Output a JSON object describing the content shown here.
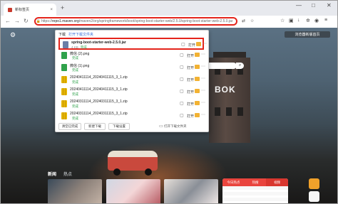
{
  "tab": {
    "title": "新标签页",
    "close_glyph": "×",
    "new_tab_glyph": "+"
  },
  "window": {
    "minimize": "—",
    "maximize": "□",
    "close": "✕"
  },
  "nav": {
    "back": "←",
    "forward": "→",
    "reload": "↻"
  },
  "address": {
    "scheme": "https://",
    "host": "repo1.maven.org",
    "path": "/maven2/org/springframework/boot/spring-boot-starter-web/2.5.0/spring-boot-starter-web-2.5.0.jar"
  },
  "page": {
    "weather": {
      "temp": "",
      "text_line1": "",
      "text_line2": ""
    },
    "browse_button": "浏览器新版首页",
    "news_tabs": [
      "新闻",
      "热点"
    ],
    "hot_tabs": [
      "今日热点",
      "热搜",
      "视频"
    ],
    "tower_logo": "BOK"
  },
  "downloads": {
    "title": "下载",
    "link": "打开下载文件夹",
    "items": [
      {
        "name": "spring-boot-starter-web-2.5.0.jar",
        "meta": "4 KB",
        "status": "完成",
        "icon": "jar-file-icon",
        "highlighted": true
      },
      {
        "name": "微信 (2).png",
        "meta": "",
        "status": "完成",
        "icon": "png-file-icon",
        "highlighted": false
      },
      {
        "name": "微信 (1).png",
        "meta": "",
        "status": "完成",
        "icon": "png-file-icon",
        "highlighted": false
      },
      {
        "name": "20240411114_20240411115_3_1.zip",
        "meta": "",
        "status": "完成",
        "icon": "zip-file-icon",
        "highlighted": false
      },
      {
        "name": "20240411114_20240411115_3_1.zip",
        "meta": "",
        "status": "完成",
        "icon": "zip-file-icon",
        "highlighted": false
      },
      {
        "name": "20240311114_20240311115_3_1.zip",
        "meta": "",
        "status": "完成",
        "icon": "zip-file-icon",
        "highlighted": false
      },
      {
        "name": "20240311114_20240311115_3_1.zip",
        "meta": "",
        "status": "完成",
        "icon": "zip-file-icon",
        "highlighted": false
      }
    ],
    "open_label": "打开",
    "footer": {
      "clear": "清空已完成",
      "new": "新建下载",
      "settings": "下载设置",
      "open_folder": "打开下载文件夹"
    }
  },
  "colors": {
    "highlight": "#e4241b",
    "link": "#3a6fd8",
    "done": "#2fa24b"
  }
}
